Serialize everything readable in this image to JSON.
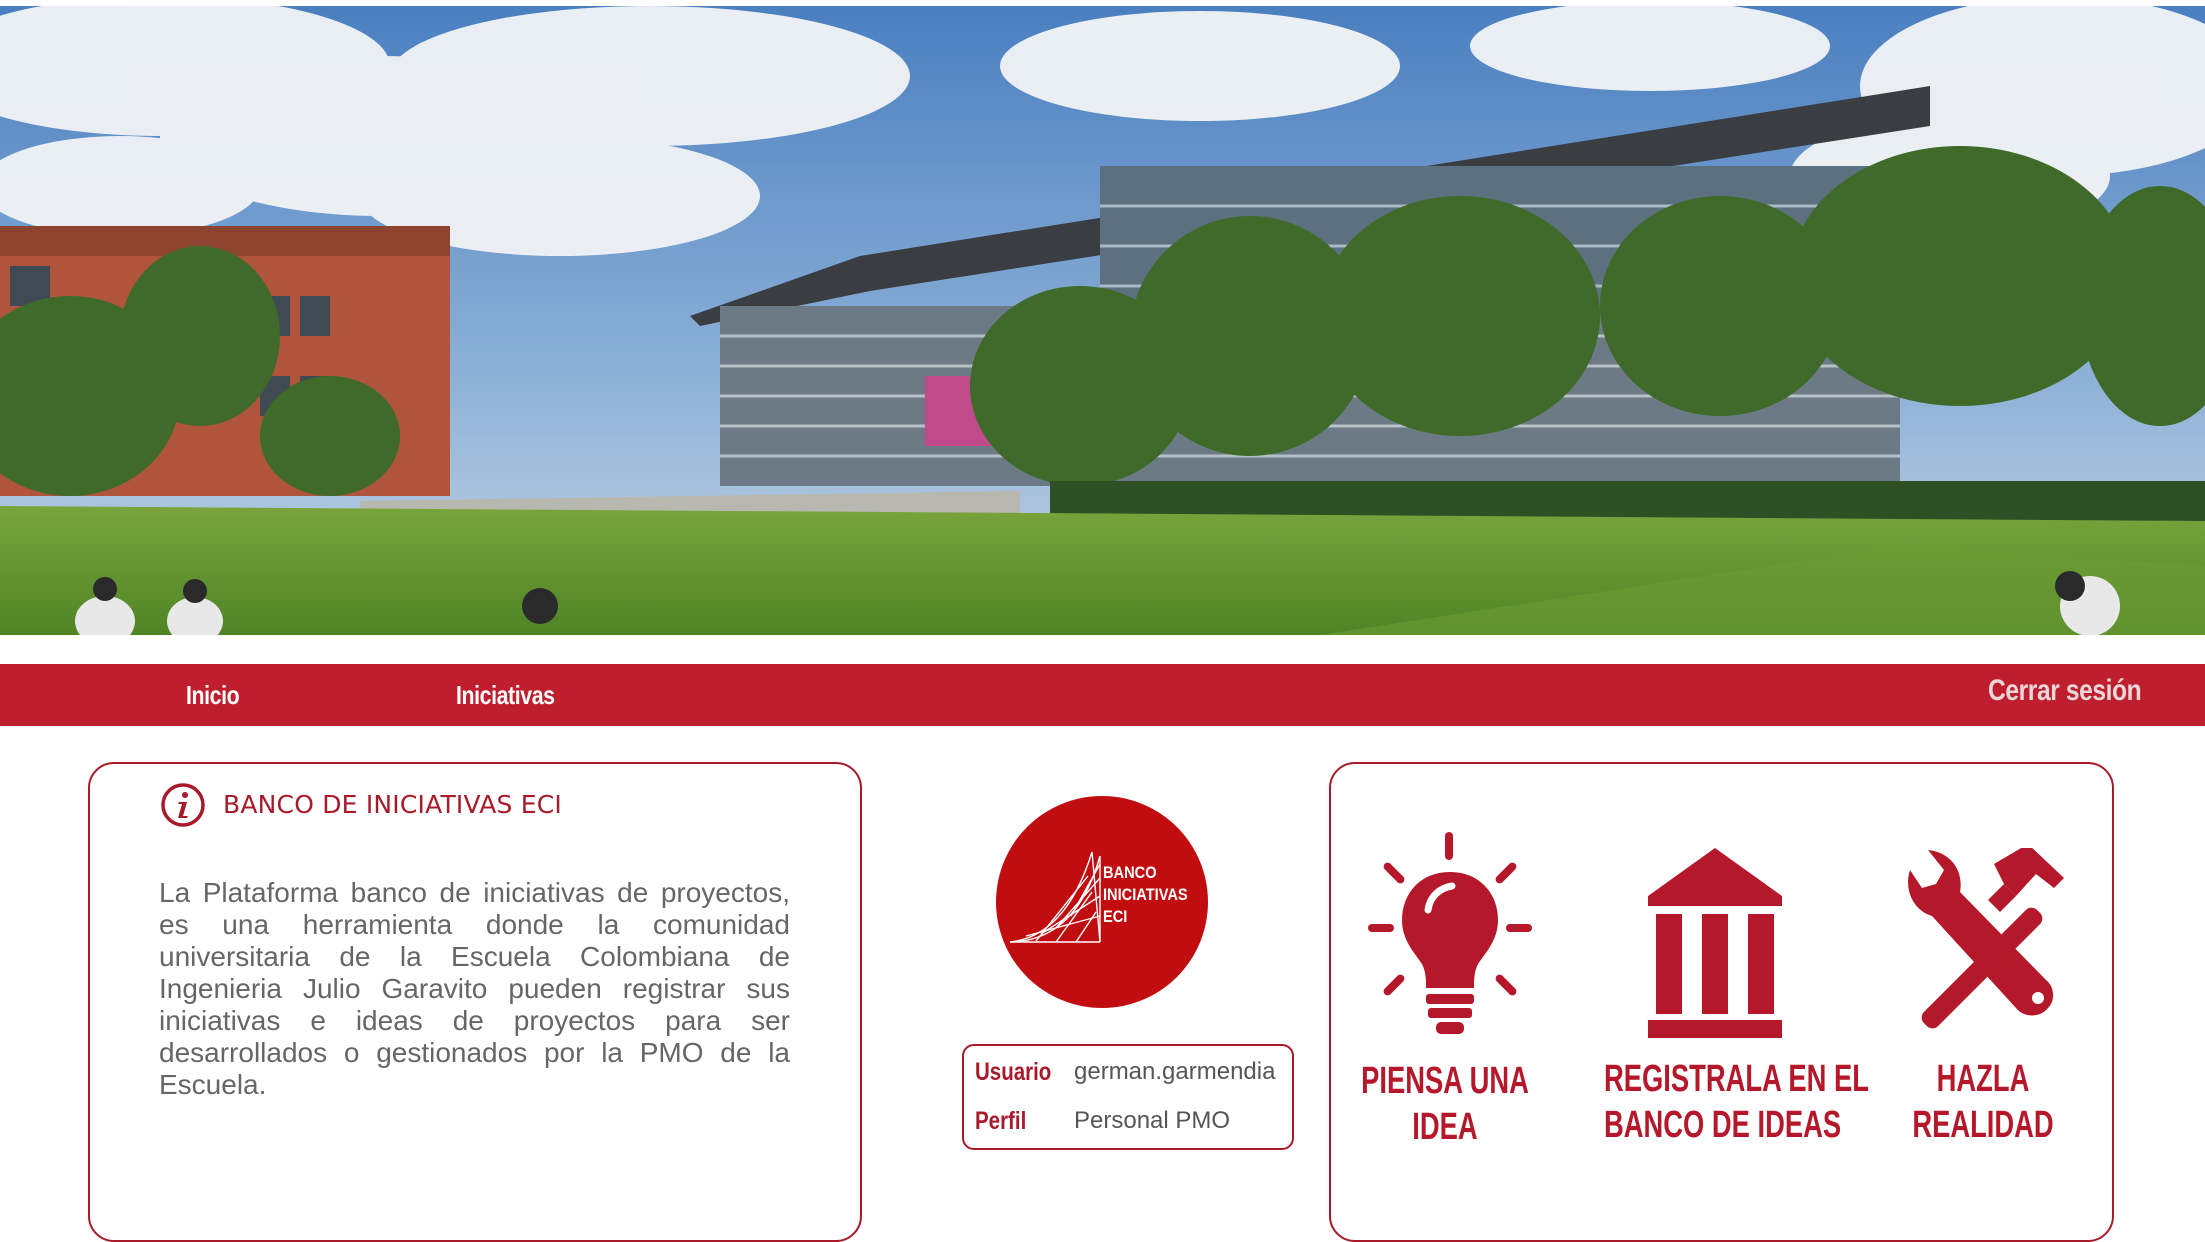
{
  "nav": {
    "links": [
      "Inicio",
      "Iniciativas"
    ],
    "logout": "Cerrar sesión"
  },
  "info_card": {
    "icon": "info-icon",
    "title": "BANCO DE INICIATIVAS ECI",
    "text": "La Plataforma banco de iniciativas de proyectos, es una herramienta donde la comunidad universitaria de la Escuela Colombiana de Ingenieria Julio Garavito pueden registrar sus iniciativas e ideas de proyectos para ser desarrollados o gestionados por la PMO de la Escuela."
  },
  "logo": {
    "lines": [
      "BANCO",
      "INICIATIVAS",
      "ECI"
    ]
  },
  "user": {
    "usuario_label": "Usuario",
    "usuario_value": "german.garmendia",
    "perfil_label": "Perfil",
    "perfil_value": "Personal PMO"
  },
  "steps": [
    {
      "icon": "lightbulb-icon",
      "line1": "PIENSA UNA",
      "line2": "IDEA"
    },
    {
      "icon": "bank-icon",
      "line1": "REGISTRALA EN EL",
      "line2": "BANCO DE IDEAS"
    },
    {
      "icon": "tools-icon",
      "line1": "HAZLA",
      "line2": "REALIDAD"
    }
  ],
  "colors": {
    "brand_red": "#bf1e2e",
    "text_red": "#a8192a",
    "body_text": "#666666"
  }
}
